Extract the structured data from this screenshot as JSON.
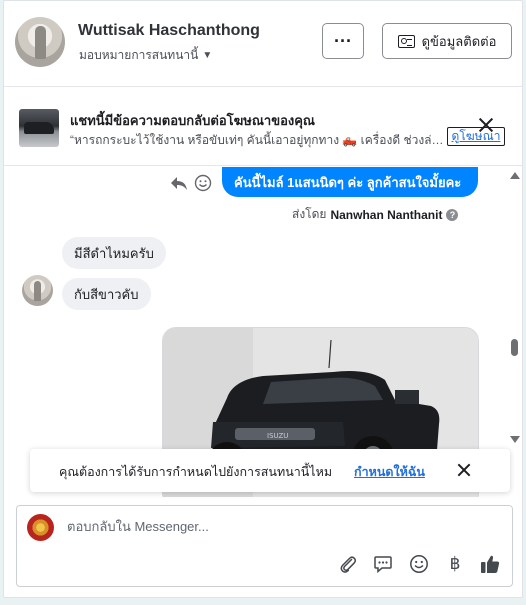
{
  "header": {
    "name": "Wuttisak Haschanthong",
    "assign_label": "มอบหมายการสนทนานี้",
    "more_label": "···",
    "contact_label": "ดูข้อมูลติดต่อ"
  },
  "ad_notice": {
    "title": "แชทนี้มีข้อความตอบกลับต่อโฆษณาของคุณ",
    "preview": "“หารถกระบะไว้ใช้งาน หรือขับเท่ๆ คันนี้เอาอยู่ทุกทาง 🛻 เครื่องดี ช่วงล่างแน่น",
    "view_label": "ดูโฆษณา"
  },
  "thread": {
    "outgoing_message": "คันนี้ไมล์ 1แสนนิดๆ ค่ะ  ลูกค้าสนใจมั้ยคะ",
    "sent_by_prefix": "ส่งโดย",
    "sent_by_name": "Nanwhan Nanthanit",
    "help_glyph": "?",
    "incoming_1": "มีสีดำไหมครับ",
    "incoming_2": "กับสีขาวคับ"
  },
  "reminder": {
    "text": "คุณต้องการได้รับการกำหนดไปยังการสนทนานี้ไหม",
    "action": "กำหนดให้ฉัน"
  },
  "composer": {
    "placeholder": "ตอบกลับใน Messenger...",
    "value": "",
    "baht_symbol": "฿"
  },
  "icons": [
    "id-card-icon",
    "close-icon",
    "reply-icon",
    "emoji-icon",
    "help-icon",
    "paperclip-icon",
    "saved-reply-icon",
    "baht-icon",
    "thumbs-up-icon",
    "chevron-down-icon"
  ],
  "colors": {
    "accent": "#0084ff",
    "link": "#216fdb",
    "bubble_in": "#eef0f3",
    "page_bg": "#e9f2f3"
  }
}
